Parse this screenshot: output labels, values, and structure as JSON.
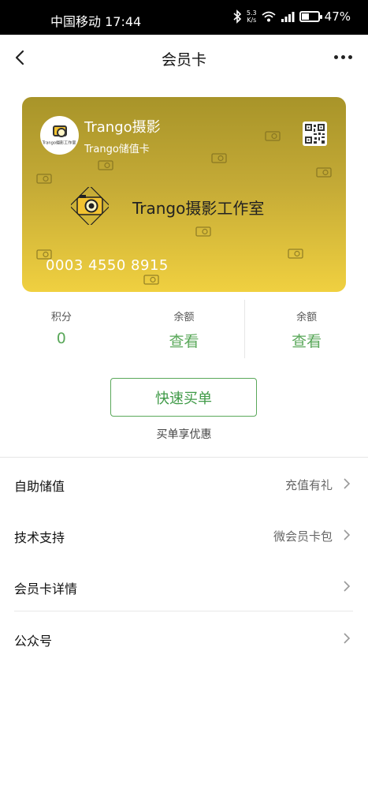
{
  "status_bar": {
    "carrier_time": "中国移动 17:44",
    "speed_value": "5.3",
    "speed_unit": "K/s",
    "battery": "47%",
    "battery_level": 0.47
  },
  "nav": {
    "title": "会员卡"
  },
  "card": {
    "name": "Trango摄影",
    "subtitle": "Trango储值卡",
    "logo_text": "Trango摄影工作室",
    "studio_name": "Trango摄影工作室",
    "number": "0003 4550 8915",
    "colors": {
      "top": "#a89429",
      "bottom": "#f0d040"
    }
  },
  "stats": [
    {
      "label": "积分",
      "value": "0"
    },
    {
      "label": "余额",
      "value": "查看"
    },
    {
      "label": "余额",
      "value": "查看"
    }
  ],
  "quick_buy": {
    "button": "快速买单",
    "hint": "买单享优惠"
  },
  "menu": [
    {
      "label": "自助储值",
      "value": "充值有礼"
    },
    {
      "label": "技术支持",
      "value": "微会员卡包"
    },
    {
      "label": "会员卡详情",
      "value": ""
    },
    {
      "label": "公众号",
      "value": ""
    }
  ],
  "accent_color": "#5aa85a"
}
